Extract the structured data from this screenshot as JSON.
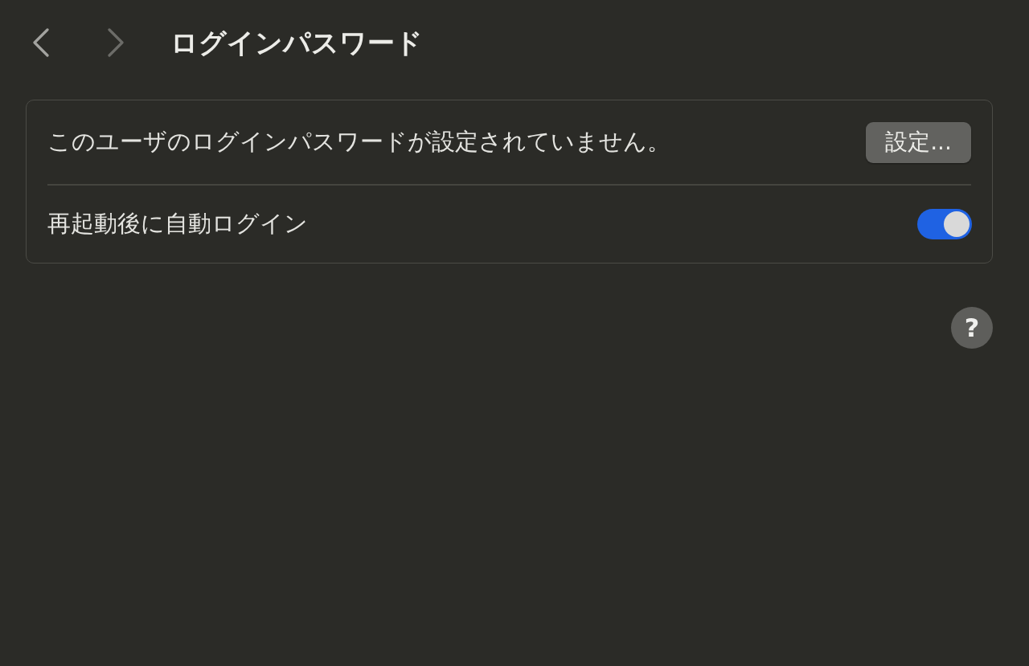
{
  "toolbar": {
    "nav": [
      {
        "kind": "back",
        "disabled": false
      },
      {
        "kind": "forward",
        "disabled": true
      }
    ],
    "title": "ログインパスワード"
  },
  "settings": {
    "rows": [
      {
        "kind": "button",
        "label": "このユーザのログインパスワードが設定されていません。",
        "button": "設定..."
      },
      {
        "kind": "toggle",
        "label": "再起動後に自動ログイン",
        "on": true
      }
    ]
  },
  "help_button": {
    "label": "?"
  }
}
